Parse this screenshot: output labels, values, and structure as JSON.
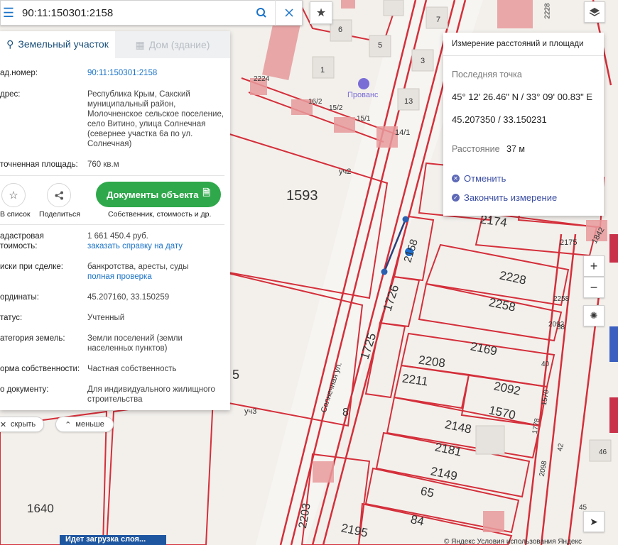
{
  "search": {
    "query": "90:11:150301:2158"
  },
  "panel": {
    "tab_land": "Земельный участок",
    "tab_building": "Дом (здание)",
    "rows": [
      {
        "key": "ад.номер:",
        "value": "90:11:150301:2158",
        "value_is_link": true
      },
      {
        "key": "дрес:",
        "value": "Республика Крым, Сакский муниципальный район, Молочненское сельское поселение, село Витино, улица Солнечная (севернее участка 6а по ул. Солнечная)"
      },
      {
        "key": "точненная площадь:",
        "value": "760 кв.м"
      }
    ],
    "actions": {
      "save_label": "В список",
      "share_label": "Поделиться",
      "doc_button": "Документы объекта",
      "doc_sub": "Собственник, стоимость и др."
    },
    "rows2": [
      {
        "key": "адастровая\nтоимость:",
        "value": "1 661 450.4 руб.",
        "link": "заказать справку на дату"
      },
      {
        "key": "иски при сделке:",
        "value": "банкротства, аресты, суды",
        "link": "полная проверка"
      },
      {
        "key": "ординаты:",
        "value": "45.207160, 33.150259"
      },
      {
        "key": "татус:",
        "value": "Учтенный"
      },
      {
        "key": "атегория земель:",
        "value": "Земли поселений (земли населенных пунктов)"
      },
      {
        "key": "орма собственности:",
        "value": "Частная собственность"
      },
      {
        "key": "о документу:",
        "value": "Для индивидуального жилищного строительства"
      }
    ],
    "hide_label": "скрыть",
    "less_label": "меньше"
  },
  "measure": {
    "title": "Измерение расстояний и площади",
    "last_point_label": "Последняя точка",
    "dms": "45° 12' 26.46\" N / 33° 09' 00.83\" E",
    "decimal": "45.207350 / 33.150231",
    "distance_label": "Расстояние",
    "distance_value": "37 м",
    "cancel": "Отменить",
    "finish": "Закончить измерение"
  },
  "map_labels": {
    "parcels": [
      "1593",
      "2174",
      "2175",
      "2228",
      "2258",
      "1726",
      "1725",
      "2169",
      "2208",
      "2211",
      "2092",
      "1570",
      "2148",
      "2181",
      "2149",
      "65",
      "84",
      "2195",
      "2203",
      "1640",
      "8",
      "2158",
      "1842",
      "5",
      "6",
      "7",
      "3",
      "1",
      "13",
      "14/1",
      "15/1",
      "15/2",
      "16/2",
      "2224",
      "2228",
      "2258",
      "2092",
      "1570",
      "1778",
      "2098",
      "42",
      "40",
      "38",
      "47",
      "45",
      "46"
    ],
    "street": "Солнечная ул.",
    "uch2": "уч2",
    "uch3": "уч3",
    "poi": "Прованс"
  },
  "banner": "Идет загрузка слоя...",
  "attribution": "© Яндекс Условия использования   Яндекс"
}
